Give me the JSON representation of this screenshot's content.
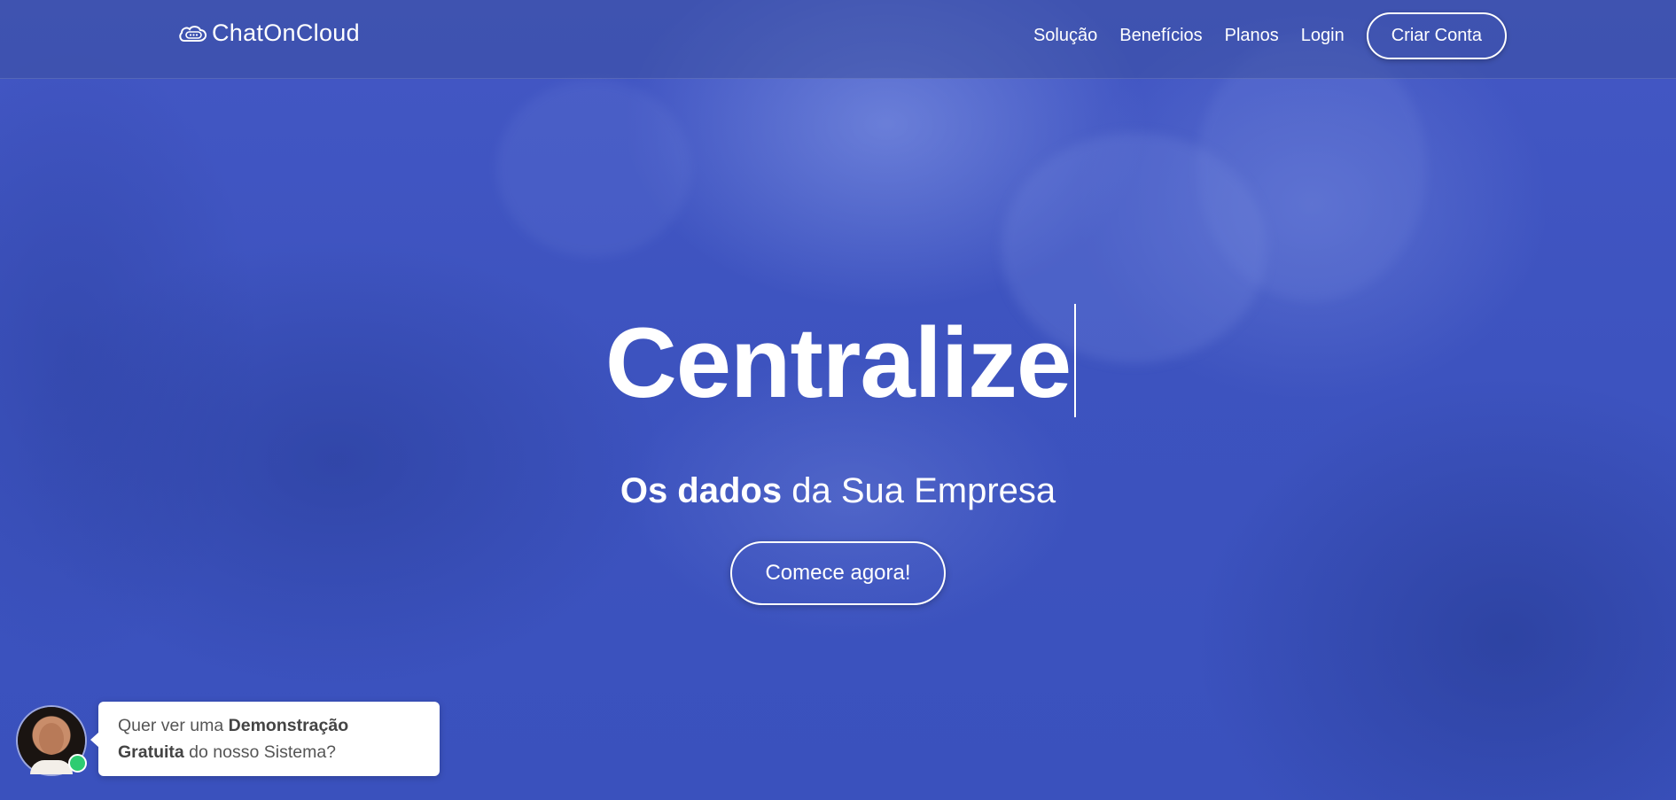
{
  "brand": {
    "logo_icon": "chat-cloud-icon",
    "name": "ChatOnCloud"
  },
  "nav": {
    "items": [
      {
        "label": "Solução"
      },
      {
        "label": "Benefícios"
      },
      {
        "label": "Planos"
      },
      {
        "label": "Login"
      }
    ],
    "cta_label": "Criar Conta"
  },
  "hero": {
    "headline": "Centralize",
    "subline_bold": "Os dados",
    "subline_rest": " da Sua Empresa",
    "cta_label": "Comece agora!"
  },
  "chat_widget": {
    "avatar_icon": "agent-avatar",
    "status": "online",
    "message_part1": "Quer ver uma ",
    "message_bold1": "Demonstração",
    "message_bold2": "Gratuita",
    "message_part2": " do nosso Sistema?"
  },
  "colors": {
    "hero_blue": "#3d53bf",
    "online_green": "#2ecc71",
    "white": "#ffffff"
  }
}
